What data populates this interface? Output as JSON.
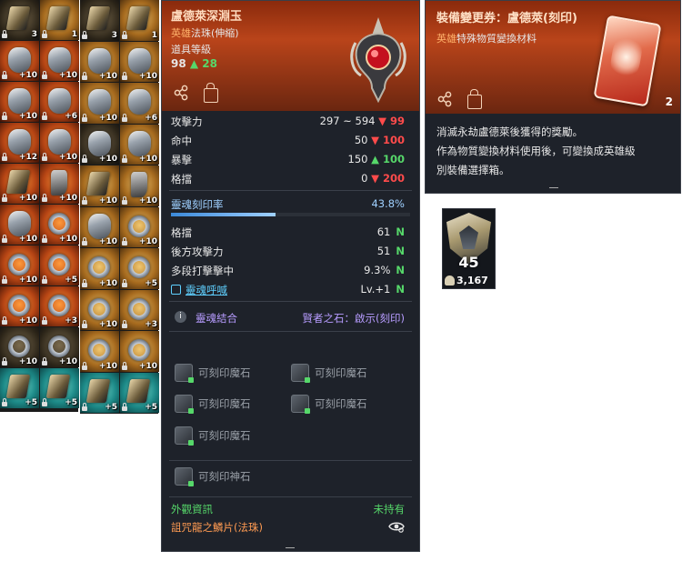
{
  "inventory_left": [
    {
      "slot": "weapon",
      "bg": "k",
      "count": "3",
      "locked": true
    },
    {
      "slot": "weapon",
      "bg": "g",
      "count": "1",
      "locked": true
    },
    {
      "slot": "armor",
      "bg": "o",
      "count": "+10",
      "locked": true
    },
    {
      "slot": "wings",
      "bg": "o",
      "count": "+10",
      "locked": true
    },
    {
      "slot": "armor",
      "bg": "o",
      "count": "+10",
      "locked": true
    },
    {
      "slot": "belt",
      "bg": "o",
      "count": "+6",
      "locked": true
    },
    {
      "slot": "pants",
      "bg": "o",
      "count": "+12",
      "locked": true
    },
    {
      "slot": "gauntlet",
      "bg": "o",
      "count": "+10",
      "locked": true
    },
    {
      "slot": "claw",
      "bg": "o",
      "count": "+10",
      "locked": true
    },
    {
      "slot": "boot",
      "bg": "o",
      "count": "+10",
      "locked": true
    },
    {
      "slot": "gem",
      "bg": "o",
      "count": "+10",
      "locked": true
    },
    {
      "slot": "ring",
      "bg": "o",
      "count": "+10",
      "locked": true
    },
    {
      "slot": "ring",
      "bg": "o",
      "count": "+10",
      "locked": true
    },
    {
      "slot": "ring",
      "bg": "o",
      "count": "+5",
      "locked": true
    },
    {
      "slot": "ring",
      "bg": "o",
      "count": "+10",
      "locked": true
    },
    {
      "slot": "ring",
      "bg": "o",
      "count": "+3",
      "locked": true
    },
    {
      "slot": "ring",
      "bg": "k",
      "count": "+10",
      "locked": true
    },
    {
      "slot": "ring",
      "bg": "k",
      "count": "+10",
      "locked": true
    },
    {
      "slot": "claw",
      "bg": "t",
      "count": "+5",
      "locked": true
    },
    {
      "slot": "claw",
      "bg": "t",
      "count": "+5",
      "locked": true
    }
  ],
  "inventory_right": [
    {
      "slot": "weapon",
      "bg": "k",
      "count": "3",
      "locked": true
    },
    {
      "slot": "weapon",
      "bg": "g",
      "count": "1",
      "locked": true
    },
    {
      "slot": "armor",
      "bg": "g",
      "count": "+10",
      "locked": true
    },
    {
      "slot": "wings",
      "bg": "g",
      "count": "+10",
      "locked": true
    },
    {
      "slot": "armor",
      "bg": "g",
      "count": "+10",
      "locked": true
    },
    {
      "slot": "belt",
      "bg": "g",
      "count": "+6",
      "locked": true
    },
    {
      "slot": "pants",
      "bg": "k",
      "count": "+10",
      "locked": true
    },
    {
      "slot": "gauntlet",
      "bg": "g",
      "count": "+10",
      "locked": true
    },
    {
      "slot": "claw",
      "bg": "g",
      "count": "+10",
      "locked": true
    },
    {
      "slot": "boot",
      "bg": "g",
      "count": "+10",
      "locked": true
    },
    {
      "slot": "gem",
      "bg": "g",
      "count": "+10",
      "locked": true
    },
    {
      "slot": "ring",
      "bg": "g",
      "count": "+10",
      "locked": true
    },
    {
      "slot": "ring",
      "bg": "g",
      "count": "+10",
      "locked": true
    },
    {
      "slot": "ring",
      "bg": "g",
      "count": "+5",
      "locked": true
    },
    {
      "slot": "ring",
      "bg": "g",
      "count": "+10",
      "locked": true
    },
    {
      "slot": "ring",
      "bg": "g",
      "count": "+3",
      "locked": true
    },
    {
      "slot": "ring",
      "bg": "g",
      "count": "+10",
      "locked": true
    },
    {
      "slot": "ring",
      "bg": "g",
      "count": "+10",
      "locked": true
    },
    {
      "slot": "claw",
      "bg": "t",
      "count": "+5",
      "locked": true
    },
    {
      "slot": "claw",
      "bg": "t",
      "count": "+5",
      "locked": true
    }
  ],
  "tooltip": {
    "title": "盧德萊深淵玉",
    "rarity": "英雄",
    "type": "法珠(伸縮)",
    "item_level_label": "道具等級",
    "item_level": "98",
    "item_level_up": "▲ 28",
    "stats": [
      {
        "label": "攻擊力",
        "value": "297 ~ 594",
        "delta": "▼ 99",
        "dir": "dn"
      },
      {
        "label": "命中",
        "value": "50",
        "delta": "▼ 100",
        "dir": "dn"
      },
      {
        "label": "暴擊",
        "value": "150",
        "delta": "▲ 100",
        "dir": "up"
      },
      {
        "label": "格擋",
        "value": "0",
        "delta": "▼ 200",
        "dir": "dn"
      }
    ],
    "soul_rate_label": "靈魂刻印率",
    "soul_rate": "43.8%",
    "soul_rate_fraction": 0.438,
    "soul_stats": [
      {
        "label": "格擋",
        "value": "61",
        "badge": "N"
      },
      {
        "label": "後方攻擊力",
        "value": "51",
        "badge": "N"
      },
      {
        "label": "多段打擊擊中",
        "value": "9.3%",
        "badge": "N"
      }
    ],
    "soul_call_label": "靈魂呼喊",
    "soul_call_value": "Lv.+1",
    "soul_call_badge": "N",
    "combine_label": "靈魂結合",
    "combine_value": "賢者之石：啟示(刻印)",
    "combine_icon": "i",
    "sockets": [
      "可刻印魔石",
      "可刻印魔石",
      "可刻印魔石",
      "可刻印魔石",
      "可刻印魔石"
    ],
    "god_socket": "可刻印神石",
    "appearance_label": "外觀資訊",
    "appearance_value": "未持有",
    "appearance_item": "詛咒龍之鱗片(法珠)"
  },
  "voucher": {
    "title": "裝備變更券：盧德萊(刻印)",
    "rarity": "英雄",
    "type": "特殊物質變換材料",
    "count": "2",
    "desc_1": "消滅永劫盧德萊後獲得的獎勵。",
    "desc_2": "作為物質變換材料使用後，可變換成英雄級",
    "desc_3": "別裝備選擇箱。"
  },
  "emblem": {
    "level": "45",
    "points": "3,167"
  }
}
